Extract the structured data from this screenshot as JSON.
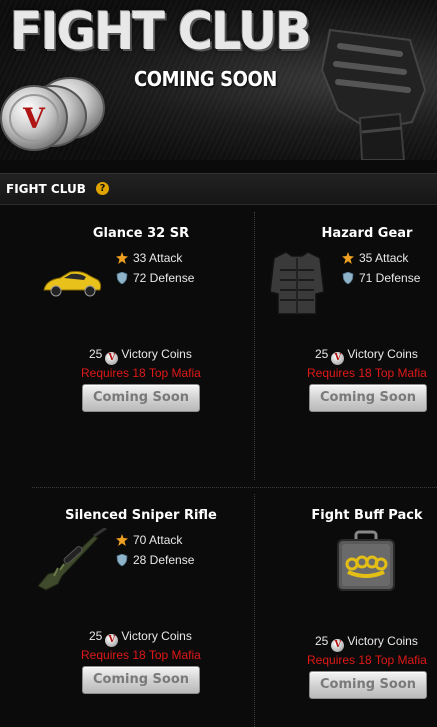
{
  "banner": {
    "title": "FIGHT CLUB",
    "subtitle": "COMING SOON",
    "coin_icon": "victory-coin-stack",
    "glove_icon": "fight-glove"
  },
  "section": {
    "title": "FIGHT CLUB",
    "help_glyph": "?"
  },
  "items": [
    {
      "name": "Glance 32 SR",
      "image": "sports-car-icon",
      "attack": "33 Attack",
      "defense": "72 Defense",
      "cost_amount": "25",
      "cost_label": "Victory Coins",
      "requirement": "Requires 18 Top Mafia",
      "button": "Coming Soon"
    },
    {
      "name": "Hazard Gear",
      "image": "body-armor-icon",
      "attack": "35 Attack",
      "defense": "71 Defense",
      "cost_amount": "25",
      "cost_label": "Victory Coins",
      "requirement": "Requires 18 Top Mafia",
      "button": "Coming Soon"
    },
    {
      "name": "Silenced Sniper Rifle",
      "image": "sniper-rifle-icon",
      "attack": "70 Attack",
      "defense": "28 Defense",
      "cost_amount": "25",
      "cost_label": "Victory Coins",
      "requirement": "Requires 18 Top Mafia",
      "button": "Coming Soon"
    },
    {
      "name": "Fight Buff Pack",
      "image": "brass-knuckles-case-icon",
      "cost_amount": "25",
      "cost_label": "Victory Coins",
      "requirement": "Requires 18 Top Mafia",
      "button": "Coming Soon"
    }
  ],
  "colors": {
    "background": "#0b0b0b",
    "requirement_text": "#e01818",
    "attack_icon": "#f0a020",
    "defense_icon": "#8fb3c9",
    "button_text": "#7a7a7a"
  },
  "coin_glyph": "V"
}
